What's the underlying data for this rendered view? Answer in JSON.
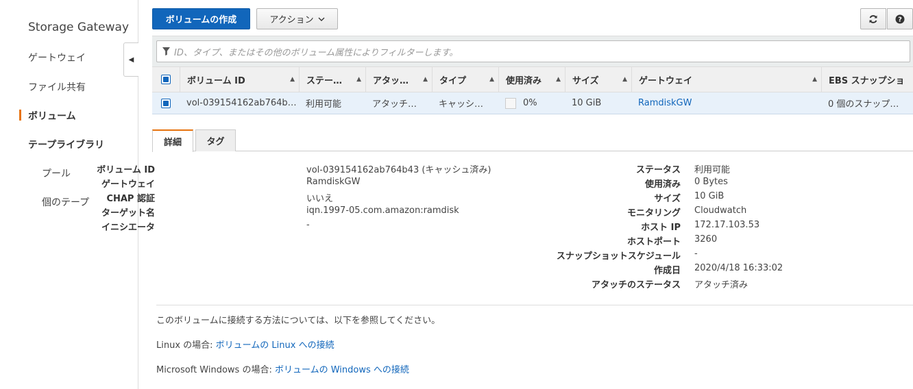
{
  "sidebar": {
    "title": "Storage Gateway",
    "items": [
      {
        "label": "ゲートウェイ"
      },
      {
        "label": "ファイル共有"
      },
      {
        "label": "ボリューム"
      },
      {
        "label": "テープライブラリ"
      },
      {
        "label": "プール"
      },
      {
        "label": "個のテープ"
      }
    ]
  },
  "toolbar": {
    "create_label": "ボリュームの作成",
    "action_label": "アクション"
  },
  "filter": {
    "placeholder": "ID、タイプ、またはその他のボリューム属性によりフィルターします。"
  },
  "table": {
    "headers": [
      "ボリューム ID",
      "ステータス",
      "アタッチのステータス",
      "タイプ",
      "使用済み",
      "サイズ",
      "ゲートウェイ",
      "EBS スナップショット"
    ],
    "headers_display": [
      "ボリューム ID",
      "ステー…",
      "アタッ…",
      "タイプ",
      "使用済み",
      "サイズ",
      "ゲートウェイ",
      "EBS スナップショ"
    ],
    "row": {
      "volume_id": "vol-039154162ab764b…",
      "status": "利用可能",
      "attach": "アタッチ…",
      "type": "キャッシ…",
      "used": "0%",
      "size": "10 GiB",
      "gateway": "RamdiskGW",
      "ebs": "0 個のスナップ…"
    }
  },
  "tabs": {
    "details": "詳細",
    "tags": "タグ"
  },
  "details_left": [
    {
      "label": "ボリューム ID",
      "value": "vol-039154162ab764b43 (キャッシュ済み)"
    },
    {
      "label": "ゲートウェイ",
      "value": "RamdiskGW"
    },
    {
      "label": "CHAP 認証",
      "value": "いいえ"
    },
    {
      "label": "ターゲット名",
      "value": "iqn.1997-05.com.amazon:ramdisk"
    },
    {
      "label": "イニシエータ",
      "value": "-"
    }
  ],
  "details_right": [
    {
      "label": "ステータス",
      "value": "利用可能"
    },
    {
      "label": "使用済み",
      "value": "0 Bytes"
    },
    {
      "label": "サイズ",
      "value": "10 GiB"
    },
    {
      "label": "モニタリング",
      "value": "Cloudwatch"
    },
    {
      "label": "ホスト IP",
      "value": "172.17.103.53"
    },
    {
      "label": "ホストポート",
      "value": "3260"
    },
    {
      "label": "スナップショットスケジュール",
      "value": "-"
    },
    {
      "label": "作成日",
      "value": "2020/4/18 16:33:02"
    },
    {
      "label": "アタッチのステータス",
      "value": "アタッチ済み"
    }
  ],
  "connect": {
    "intro": "このボリュームに接続する方法については、以下を参照してください。",
    "linux_prefix": "Linux の場合: ",
    "linux_link": "ボリュームの Linux への接続",
    "windows_prefix": "Microsoft Windows の場合: ",
    "windows_link": "ボリュームの Windows への接続"
  },
  "colors": {
    "primary": "#1166bb",
    "accent": "#e7730e",
    "selected_row": "#e8f1fa"
  }
}
